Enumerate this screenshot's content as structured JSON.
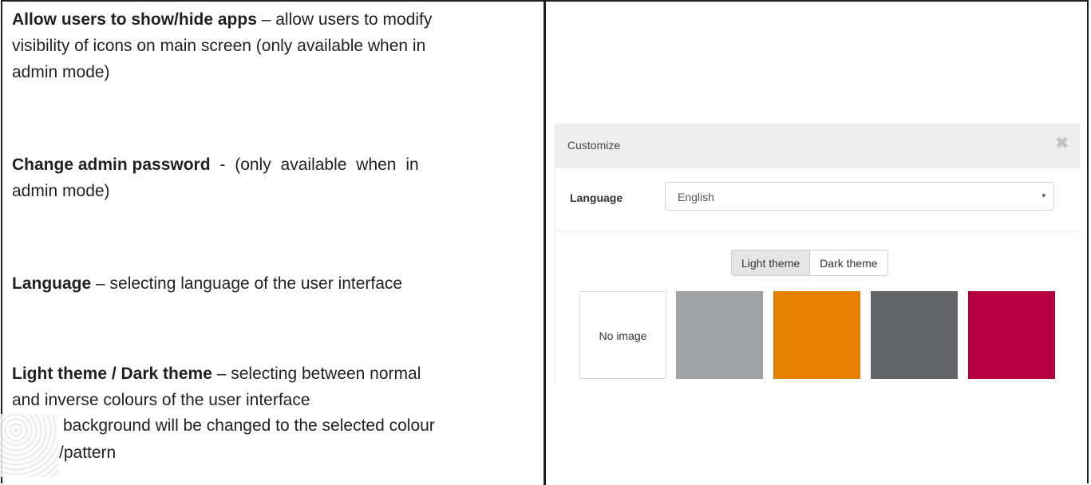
{
  "doc": {
    "allow_apps_title": "Allow users to show/hide apps",
    "allow_apps_desc_line1": " – allow users to modify",
    "allow_apps_desc_line2": "visibility of icons on main screen (only available when in",
    "allow_apps_desc_line3": "admin mode)",
    "change_pw_title": "Change admin password",
    "change_pw_desc_line1": " - (only available when in",
    "change_pw_desc_line2": "admin mode)",
    "language_title": "Language",
    "language_desc": " – selecting language of the user interface",
    "theme_title": "Light theme / Dark theme",
    "theme_desc_line1": " – selecting between normal",
    "theme_desc_line2": "and inverse colours of the user interface",
    "background_desc_line1": " background will be changed to the selected colour",
    "background_desc_line2": "/pattern"
  },
  "dialog": {
    "title": "Customize",
    "close_glyph": "✖",
    "language_label": "Language",
    "language_value": "English",
    "caret": "▾",
    "themes": [
      "Light theme",
      "Dark theme"
    ],
    "active_theme": "Light theme",
    "no_image_label": "No image",
    "swatches": [
      {
        "name": "gray",
        "color": "#a0a1a5"
      },
      {
        "name": "orange",
        "color": "#e58000"
      },
      {
        "name": "dark-gray",
        "color": "#636468"
      },
      {
        "name": "crimson",
        "color": "#b4003f"
      }
    ]
  },
  "colors": {
    "text": "#231f20",
    "header_bg": "#eeeeee",
    "active_button_bg": "#e6e6e6"
  }
}
